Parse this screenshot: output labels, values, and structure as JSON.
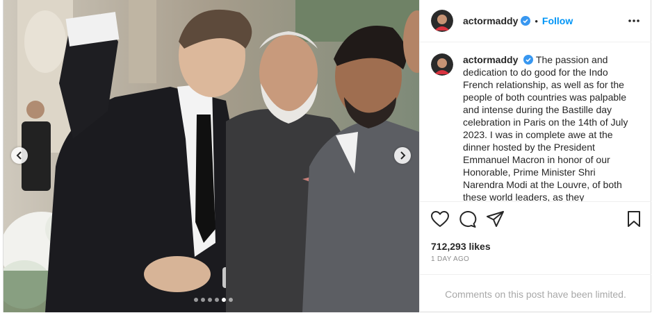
{
  "post": {
    "username": "actormaddy",
    "verified": true,
    "separator": "•",
    "follow_label": "Follow",
    "more_icon": "more-horizontal-icon",
    "caption": "The passion and dedication to do good for the Indo French relationship, as well as for the people of both countries was palpable and intense during the Bastille day celebration in Paris on the 14th of July 2023. I was in complete awe at the dinner hosted by the President Emmanuel Macron in honor of our Honorable, Prime Minister Shri Narendra Modi at the Louvre, of both these world leaders, as they",
    "likes": "712,293 likes",
    "time": "1 DAY AGO",
    "comments_notice": "Comments on this post have been limited."
  },
  "carousel": {
    "slide_count": 6,
    "active_index": 4,
    "prev_icon": "chevron-left-icon",
    "next_icon": "chevron-right-icon"
  },
  "actions": {
    "like_icon": "heart-icon",
    "comment_icon": "comment-icon",
    "share_icon": "share-icon",
    "save_icon": "bookmark-icon"
  },
  "colors": {
    "accent": "#0095f6",
    "verified": "#3897f0",
    "text": "#262626",
    "muted": "#8e8e8e"
  }
}
